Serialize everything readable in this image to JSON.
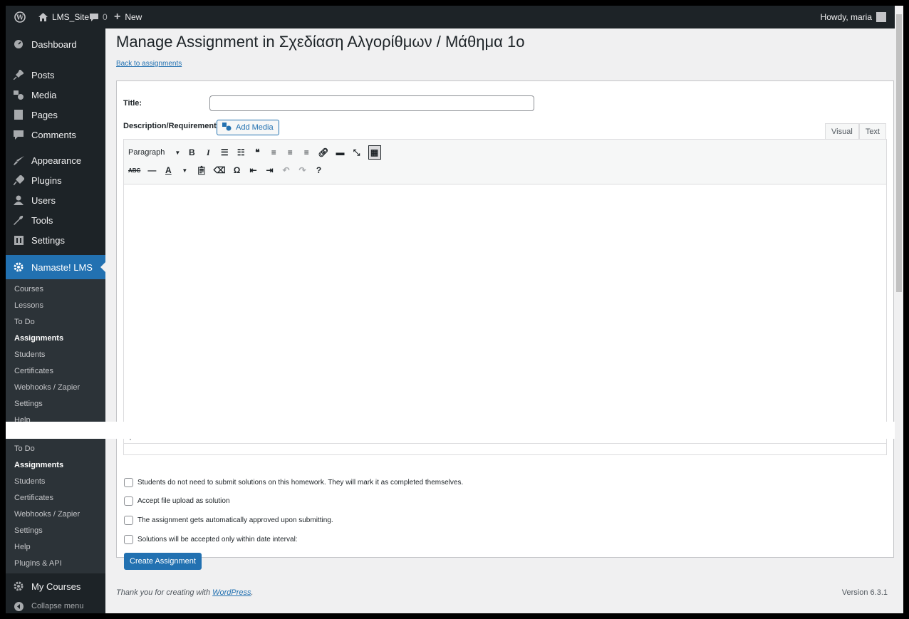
{
  "adminbar": {
    "site_name": "LMS_Site",
    "comments_count": "0",
    "new_label": "New",
    "greeting": "Howdy, maria"
  },
  "sidebar": {
    "menu": [
      {
        "label": "Dashboard",
        "icon": "dashboard-icon"
      },
      {
        "label": "Posts",
        "icon": "pin-icon"
      },
      {
        "label": "Media",
        "icon": "media-icon"
      },
      {
        "label": "Pages",
        "icon": "pages-icon"
      },
      {
        "label": "Comments",
        "icon": "comment-icon"
      },
      {
        "label": "Appearance",
        "icon": "brush-icon"
      },
      {
        "label": "Plugins",
        "icon": "plug-icon"
      },
      {
        "label": "Users",
        "icon": "users-icon"
      },
      {
        "label": "Tools",
        "icon": "wrench-icon"
      },
      {
        "label": "Settings",
        "icon": "settings-icon"
      }
    ],
    "active": {
      "label": "Namaste! LMS",
      "icon": "gear-icon"
    },
    "submenu": [
      "Courses",
      "Lessons",
      "To Do",
      "Assignments",
      "Students",
      "Certificates",
      "Webhooks / Zapier",
      "Settings",
      "Help"
    ],
    "submenu_repeat": [
      "To Do",
      "Assignments",
      "Students",
      "Certificates",
      "Webhooks / Zapier",
      "Settings",
      "Help",
      "Plugins & API"
    ],
    "my_courses": "My Courses",
    "collapse": "Collapse menu"
  },
  "page": {
    "title": "Manage Assignment in Σχεδίαση Αλγορίθμων / Μάθημα 1ο",
    "back_link": "Back to assignments",
    "title_label": "Title:",
    "title_value": "",
    "desc_label": "Description/Requirements:",
    "add_media": "Add Media",
    "tab_visual": "Visual",
    "tab_text": "Text",
    "format_select": "Paragraph",
    "path_indicator": "p",
    "checkboxes": [
      "Students do not need to submit solutions on this homework. They will mark it as completed themselves.",
      "Accept file upload as solution",
      "The assignment gets automatically approved upon submitting.",
      "Solutions will be accepted only within date interval:"
    ],
    "submit": "Create Assignment"
  },
  "footer": {
    "thanks_prefix": "Thank you for creating with ",
    "thanks_link": "WordPress",
    "thanks_suffix": ".",
    "version": "Version 6.3.1"
  },
  "colors": {
    "accent": "#2271b1",
    "sidebar": "#1d2327",
    "submenu": "#2c3338"
  }
}
